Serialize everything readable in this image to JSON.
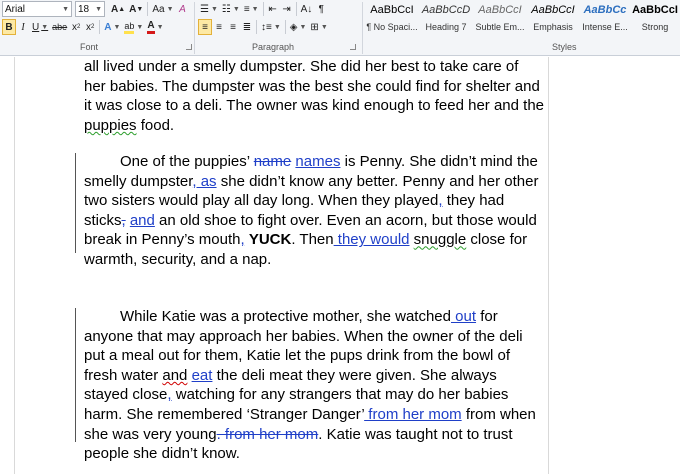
{
  "ribbon": {
    "font": {
      "name": "Arial",
      "size": "18",
      "label": "Font"
    },
    "paragraph_label": "Paragraph",
    "styles_label": "Styles",
    "styles": [
      {
        "sample": "AaBbCcI",
        "name": "¶ No Spaci..."
      },
      {
        "sample": "AaBbCcD",
        "name": "Heading 7"
      },
      {
        "sample": "AaBbCcI",
        "name": "Subtle Em..."
      },
      {
        "sample": "AaBbCcI",
        "name": "Emphasis"
      },
      {
        "sample": "AaBbCc",
        "name": "Intense E..."
      },
      {
        "sample": "AaBbCcI",
        "name": "Strong"
      }
    ],
    "colors": {
      "highlight": "#ffe14d",
      "font_color": "#d41919",
      "style_blue": "#2d6fbf"
    }
  },
  "document": {
    "p1": {
      "t1": "all lived under a smelly dumpster. She did her best to take care of her babies. The dumpster was the best she could find for shelter and it was close to a deli. The owner was kind enough to feed her and the ",
      "t2": "puppies",
      "t3": " food."
    },
    "p2": {
      "t1": "One of the puppies’ ",
      "del1": "name",
      "t2": " ",
      "ins1": "names",
      "t3": " is Penny. She didn’t mind the smelly dumpster",
      "ins2": ", as",
      "t4": " she didn’t know any better. Penny and her other two sisters would play all day long. When they played",
      "ins3": ",",
      "t5": " they had sticks",
      "del2": ",",
      "t6": " ",
      "ins4": "and",
      "t7": " an old shoe to fight over. Even an acorn, but those would break in Penny’s mouth",
      "ins5": ",",
      "t8": " ",
      "bold1": "YUCK",
      "t9": ". Then",
      "ins6": " they would",
      "t10": " ",
      "spell1": "snuggle",
      "t11": " close for warmth, security, and a nap."
    },
    "p3": {
      "t1": "While Katie was a protective mother, she watched",
      "ins1": " out",
      "t2": " for anyone that may approach her babies. When the owner of the deli put a meal out for them, Katie let the pups drink from the bowl of fresh water ",
      "spell1": "and",
      "t3": " ",
      "ins2": "eat",
      "t4": " the deli meat they were given. She always stayed close",
      "ins3": ",",
      "t5": " watching for any strangers that may do her babies harm. She remembered ‘Stranger Danger’",
      "ins4": " from her mom",
      "t6": " from when she was very young",
      "del1": ". from her mom",
      "t7": ". Katie was taught not to trust people she didn’t know."
    }
  }
}
